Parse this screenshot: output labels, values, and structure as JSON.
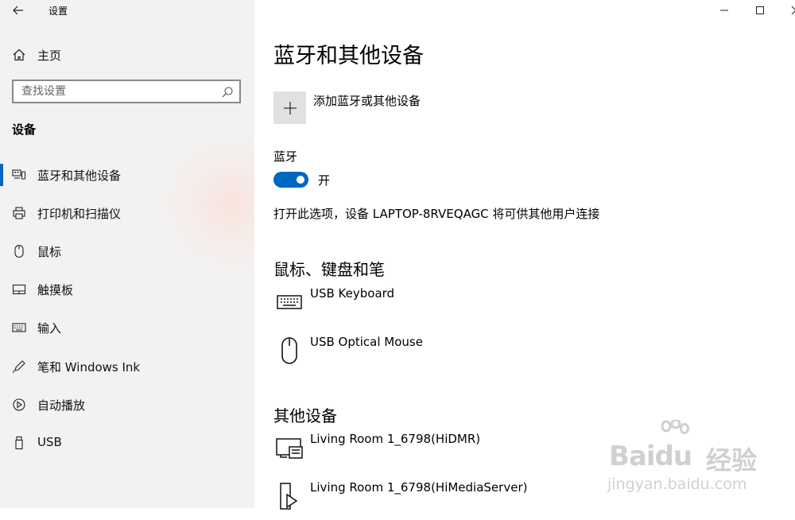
{
  "window": {
    "app_title": "设置",
    "back_icon": "arrow-left-icon",
    "controls": [
      "minimize-icon",
      "maximize-icon",
      "close-icon"
    ]
  },
  "sidebar": {
    "home_label": "主页",
    "home_icon": "home-icon",
    "search_placeholder": "查找设置",
    "search_icon": "search-icon",
    "section_title": "设备",
    "items": [
      {
        "label": "蓝牙和其他设备",
        "icon": "bluetooth-devices-icon",
        "active": true
      },
      {
        "label": "打印机和扫描仪",
        "icon": "printer-icon",
        "active": false
      },
      {
        "label": "鼠标",
        "icon": "mouse-icon",
        "active": false
      },
      {
        "label": "触摸板",
        "icon": "touchpad-icon",
        "active": false
      },
      {
        "label": "输入",
        "icon": "keyboard-icon",
        "active": false
      },
      {
        "label": "笔和 Windows Ink",
        "icon": "pen-icon",
        "active": false
      },
      {
        "label": "自动播放",
        "icon": "autoplay-icon",
        "active": false
      },
      {
        "label": "USB",
        "icon": "usb-icon",
        "active": false
      }
    ],
    "accent_color": "#0067c0"
  },
  "main": {
    "page_title": "蓝牙和其他设备",
    "add_device_label": "添加蓝牙或其他设备",
    "add_icon": "plus-icon",
    "bluetooth": {
      "label": "蓝牙",
      "state": "开",
      "on": true,
      "description": "打开此选项，设备 LAPTOP-8RVEQAGC 将可供其他用户连接"
    },
    "groups": [
      {
        "title": "鼠标、键盘和笔",
        "devices": [
          {
            "name": "USB Keyboard",
            "icon": "keyboard-icon"
          },
          {
            "name": "USB Optical Mouse",
            "icon": "mouse-icon"
          }
        ]
      },
      {
        "title": "其他设备",
        "devices": [
          {
            "name": "Living Room 1_6798(HiDMR)",
            "icon": "media-renderer-icon"
          },
          {
            "name": "Living Room 1_6798(HiMediaServer)",
            "icon": "media-server-icon"
          }
        ]
      }
    ]
  },
  "watermark": {
    "brand": "Baidu",
    "brand_text": "经验",
    "url": "jingyan.baidu.com"
  }
}
